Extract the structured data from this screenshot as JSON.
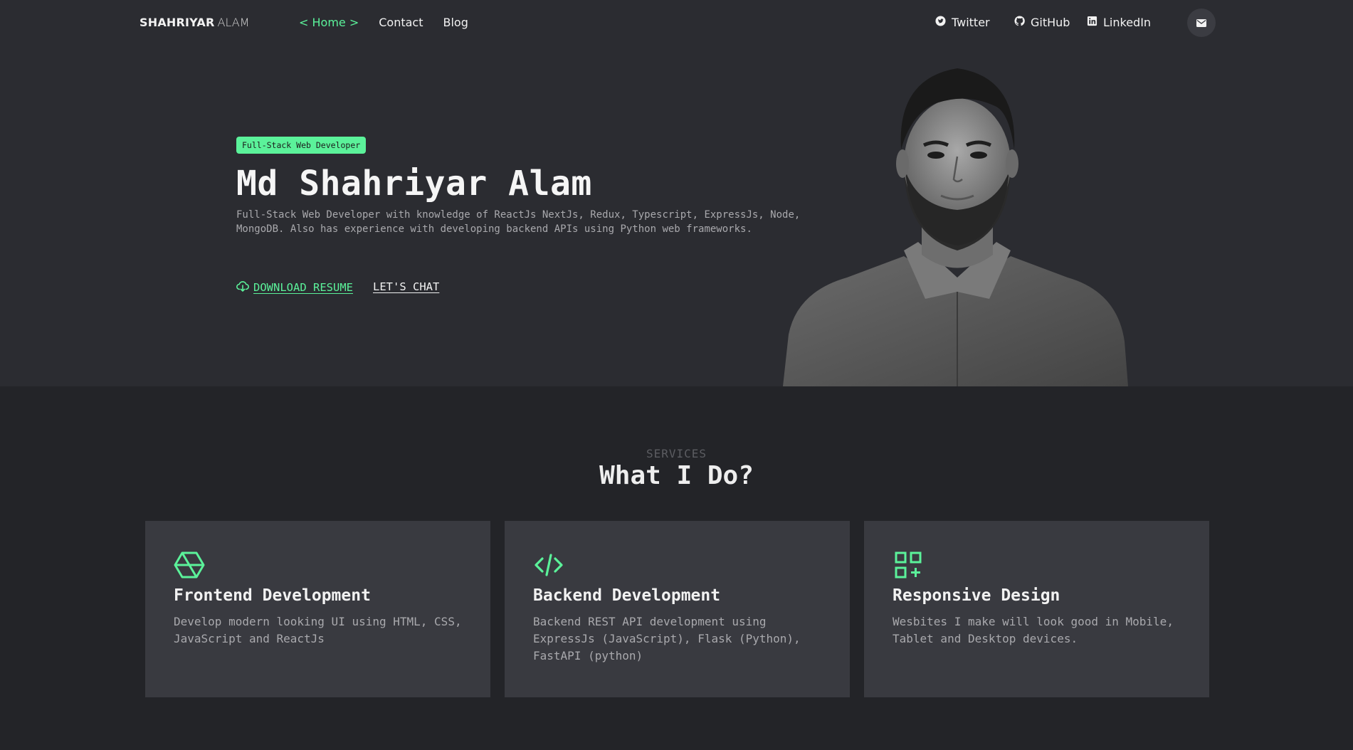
{
  "nav": {
    "brand_bold": "SHAHRIYAR",
    "brand_light": "ALAM",
    "links": [
      "< Home >",
      "Contact",
      "Blog"
    ],
    "social": [
      "Twitter",
      "GitHub",
      "LinkedIn"
    ],
    "mail_icon": "mail-icon"
  },
  "hero": {
    "badge": "Full-Stack Web Developer",
    "name": "Md Shahriyar Alam",
    "description": "Full-Stack Web Developer with knowledge of ReactJs NextJs, Redux, Typescript, ExpressJs, Node, MongoDB. Also has experience with developing backend APIs using Python web frameworks.",
    "download_label": "DOWNLOAD RESUME",
    "chat_label": "LET'S CHAT"
  },
  "services": {
    "kicker": "SERVICES",
    "title": "What I Do?",
    "cards": [
      {
        "icon": "hexagon-icon",
        "title": "Frontend Development",
        "text": "Develop modern looking UI using HTML, CSS, JavaScript and ReactJs"
      },
      {
        "icon": "code-icon",
        "title": "Backend Development",
        "text": "Backend REST API development using ExpressJs (JavaScript), Flask (Python), FastAPI (python)"
      },
      {
        "icon": "grid-plus-icon",
        "title": "Responsive Design",
        "text": "Wesbites I make will look good in Mobile, Tablet and Desktop devices."
      }
    ]
  },
  "colors": {
    "accent": "#5bf29a",
    "hero_bg": "#2b2c31",
    "page_bg": "#232428",
    "card_bg": "#393a40"
  }
}
